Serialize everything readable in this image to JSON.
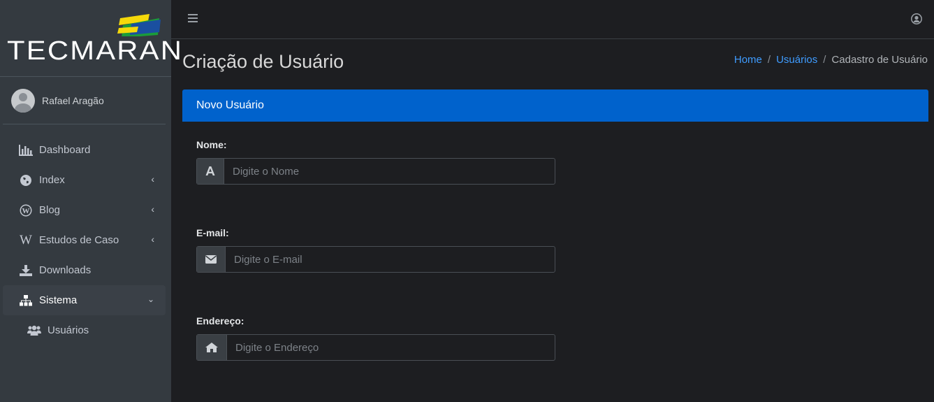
{
  "brand": {
    "name": "TECMARAN"
  },
  "user": {
    "name": "Rafael Aragão"
  },
  "sidebar": {
    "items": [
      {
        "label": "Dashboard",
        "icon": "bar-chart-icon"
      },
      {
        "label": "Index",
        "icon": "globe-icon"
      },
      {
        "label": "Blog",
        "icon": "wordpress-icon"
      },
      {
        "label": "Estudos de Caso",
        "icon": "wikipedia-icon"
      },
      {
        "label": "Downloads",
        "icon": "download-icon"
      },
      {
        "label": "Sistema",
        "icon": "sitemap-icon"
      }
    ],
    "sub_items": [
      {
        "label": "Usuários",
        "icon": "users-icon"
      }
    ]
  },
  "page": {
    "title": "Criação de Usuário"
  },
  "breadcrumb": {
    "home": "Home",
    "section": "Usuários",
    "current": "Cadastro de Usuário"
  },
  "card": {
    "title": "Novo Usuário"
  },
  "form": {
    "nome": {
      "label": "Nome:",
      "placeholder": "Digite o Nome"
    },
    "email": {
      "label": "E-mail:",
      "placeholder": "Digite o E-mail"
    },
    "endereco": {
      "label": "Endereço:",
      "placeholder": "Digite o Endereço"
    }
  },
  "colors": {
    "header_blue": "#0062cc",
    "link_blue": "#3f9cff",
    "sidebar_bg": "#343a40",
    "body_bg": "#1d1e21"
  }
}
